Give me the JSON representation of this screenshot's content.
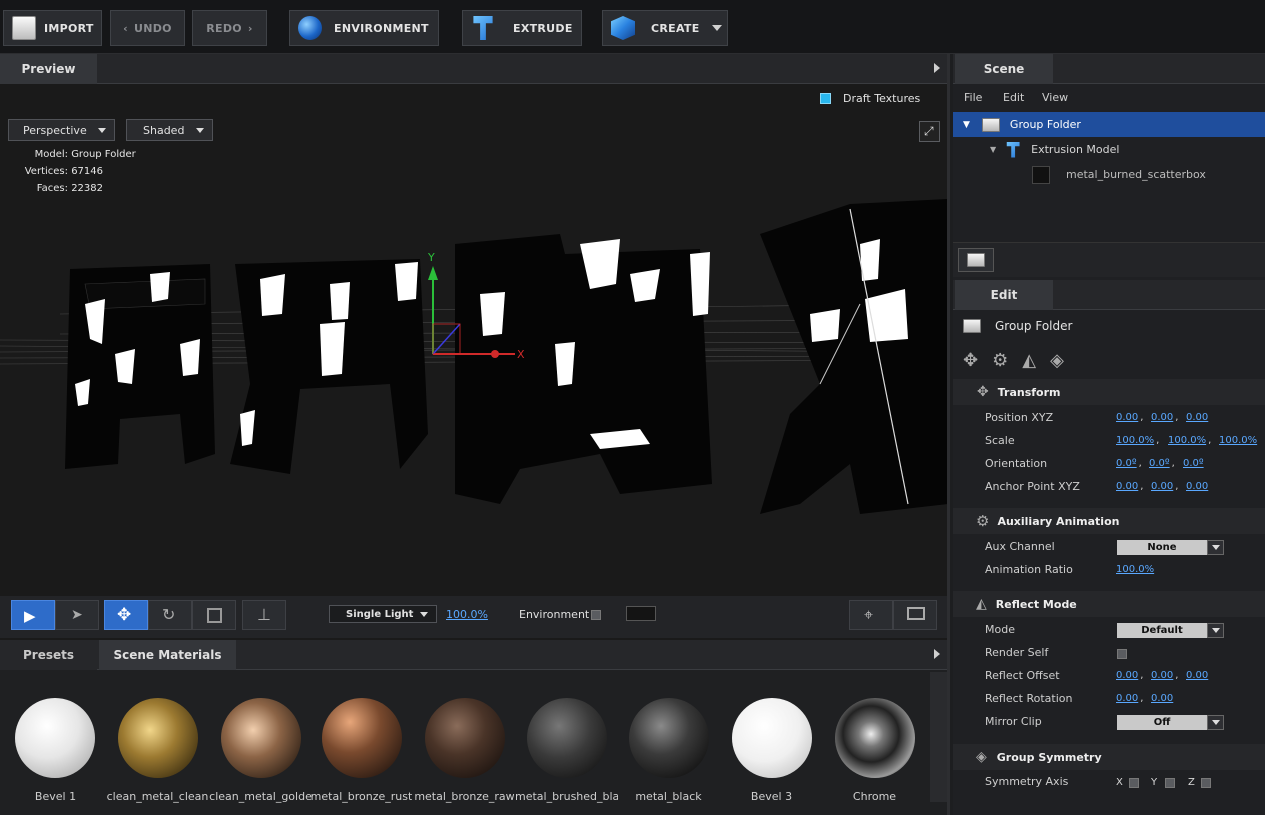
{
  "toolbar": {
    "import": "IMPORT",
    "undo": "UNDO",
    "redo": "REDO",
    "environment": "ENVIRONMENT",
    "extrude": "EXTRUDE",
    "create": "CREATE"
  },
  "preview": {
    "tab": "Preview",
    "draft_textures": "Draft Textures",
    "camera_view": "Perspective",
    "shading": "Shaded",
    "info": {
      "model_label": "Model:",
      "model_value": "Group Folder",
      "vertices_label": "Vertices:",
      "vertices_value": "67146",
      "faces_label": "Faces:",
      "faces_value": "22382"
    },
    "axes": {
      "x": "X",
      "y": "Y"
    },
    "bottom": {
      "light_mode": "Single Light",
      "light_percent": "100.0%",
      "environment_label": "Environment"
    }
  },
  "presets": {
    "tabs": [
      "Presets",
      "Scene Materials"
    ],
    "materials": [
      "Bevel 1",
      "clean_metal_clean",
      "clean_metal_golde",
      "metal_bronze_rust",
      "metal_bronze_raw",
      "metal_brushed_bla",
      "metal_black",
      "Bevel 3",
      "Chrome"
    ]
  },
  "scene": {
    "tab": "Scene",
    "menu": [
      "File",
      "Edit",
      "View"
    ],
    "tree": [
      {
        "label": "Group Folder",
        "selected": true
      },
      {
        "label": "Extrusion Model",
        "selected": false
      },
      {
        "label": "metal_burned_scatterbox",
        "selected": false
      }
    ]
  },
  "edit": {
    "tab": "Edit",
    "object_name": "Group Folder",
    "transform": {
      "title": "Transform",
      "position_label": "Position XYZ",
      "position": [
        "0.00",
        "0.00",
        "0.00"
      ],
      "scale_label": "Scale",
      "scale": [
        "100.0%",
        "100.0%",
        "100.0%"
      ],
      "orientation_label": "Orientation",
      "orientation": [
        "0.0º",
        "0.0º",
        "0.0º"
      ],
      "anchor_label": "Anchor Point XYZ",
      "anchor": [
        "0.00",
        "0.00",
        "0.00"
      ]
    },
    "aux": {
      "title": "Auxiliary Animation",
      "channel_label": "Aux Channel",
      "channel_value": "None",
      "ratio_label": "Animation Ratio",
      "ratio_value": "100.0%"
    },
    "reflect": {
      "title": "Reflect Mode",
      "mode_label": "Mode",
      "mode_value": "Default",
      "render_self_label": "Render Self",
      "offset_label": "Reflect Offset",
      "offset": [
        "0.00",
        "0.00",
        "0.00"
      ],
      "rotation_label": "Reflect Rotation",
      "rotation": [
        "0.00",
        "0.00"
      ],
      "mirror_label": "Mirror Clip",
      "mirror_value": "Off"
    },
    "symmetry": {
      "title": "Group Symmetry",
      "axis_label": "Symmetry Axis",
      "x": "X",
      "y": "Y",
      "z": "Z"
    }
  },
  "colors": {
    "accent": "#2e6cc9",
    "selection": "#1f4e9d",
    "link": "#5aa8ff"
  }
}
